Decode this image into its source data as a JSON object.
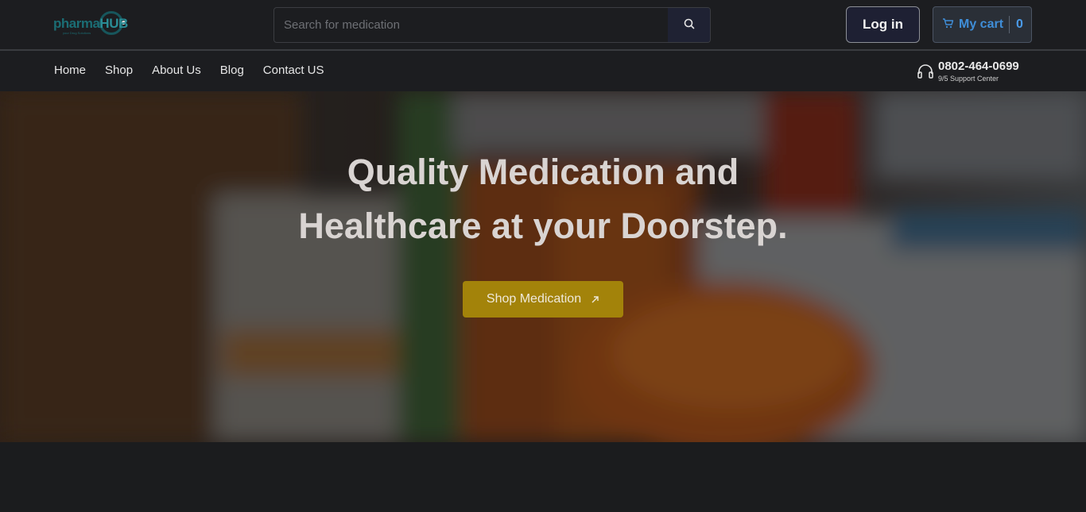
{
  "header": {
    "logo": {
      "brand": "pharmaHUB",
      "brand_primary": "pharma",
      "brand_secondary": "HUB",
      "tagline": "your Drug Solutions"
    },
    "search": {
      "placeholder": "Search for medication",
      "value": ""
    },
    "login_label": "Log in",
    "cart": {
      "label": "My cart",
      "count": "0"
    }
  },
  "nav": {
    "items": [
      {
        "label": "Home"
      },
      {
        "label": "Shop"
      },
      {
        "label": "About Us"
      },
      {
        "label": "Blog"
      },
      {
        "label": "Contact US"
      }
    ],
    "support": {
      "phone": "0802-464-0699",
      "caption": "9/5 Support Center"
    }
  },
  "hero": {
    "title_line1": "Quality Medication and",
    "title_line2": "Healthcare at your Doorstep.",
    "cta_label": "Shop Medication"
  },
  "icons": {
    "search": "search-icon",
    "cart": "cart-icon",
    "support": "headset-icon",
    "cta": "arrow-up-right-icon"
  },
  "colors": {
    "background": "#1b1c1e",
    "accent_cart": "#3f8ed8",
    "cta": "#a3830a",
    "logo": "#1b6d74"
  }
}
